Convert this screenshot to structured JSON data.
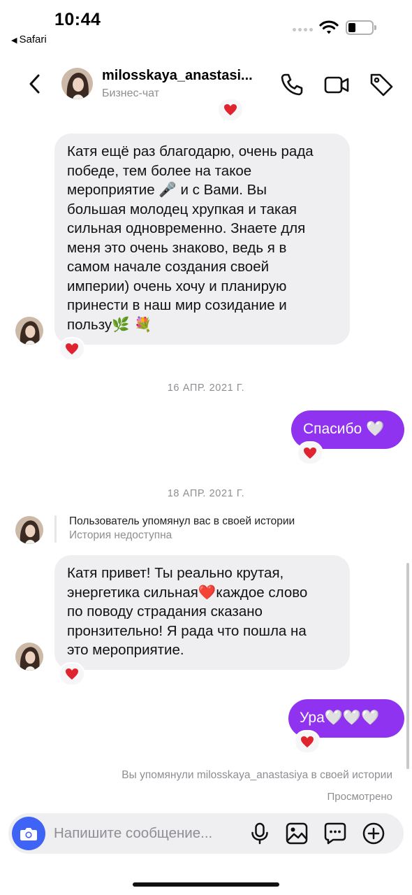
{
  "status_bar": {
    "time": "10:44",
    "back_app": "Safari",
    "back_glyph": "◀"
  },
  "header": {
    "username": "milosskaya_anastasi...",
    "subtitle": "Бизнес-чат",
    "icons": [
      "back-chevron-icon",
      "phone-icon",
      "video-camera-icon",
      "tag-icon"
    ]
  },
  "messages": {
    "msg1": {
      "sender": "incoming",
      "text_lines": [
        "Катя ещё раз благодарю, очень рада",
        "победе, тем более на такое",
        "мероприятие",
        "и с Вами. Вы",
        "большая молодец хрупкая и такая",
        "сильная одновременно. Знаете для",
        "меня это очень знаково, ведь я в",
        "самом начале создания своей",
        "империи) очень хочу и планирую",
        "принести в наш мир созидание и",
        "пользу"
      ],
      "emoji_mic": "🎤",
      "emoji_end": "🌿 💐",
      "reaction": "❤️"
    },
    "date1": "16 АПР. 2021 Г.",
    "msg2": {
      "sender": "outgoing",
      "text": "Спасибо",
      "emoji": "🤍",
      "reaction": "❤️"
    },
    "date2": "18 АПР. 2021 Г.",
    "story_mention": {
      "line1": "Пользователь упомянул вас в своей истории",
      "line2": "История недоступна"
    },
    "msg3": {
      "sender": "incoming",
      "line1": "Катя привет! Ты реально крутая,",
      "line2a": "энергетика сильная",
      "heart": "❤️",
      "line2b": "каждое слово",
      "line3": "по поводу страдания сказано",
      "line4": "пронзительно! Я рада что пошла на",
      "line5": "это мероприятие.",
      "reaction": "❤️"
    },
    "msg4": {
      "sender": "outgoing",
      "text": "Ура",
      "emoji": "🤍🤍🤍",
      "reaction": "❤️"
    },
    "mention_note": "Вы упомянули milosskaya_anastasiya в своей истории",
    "seen": "Просмотрено"
  },
  "composer": {
    "placeholder": "Напишите сообщение...",
    "icons": [
      "camera-icon",
      "microphone-icon",
      "gallery-icon",
      "sticker-chat-icon",
      "plus-icon"
    ]
  },
  "colors": {
    "outgoing_bubble": "#8f33f0",
    "incoming_bubble": "#efeff2",
    "camera_button": "#3f64f5",
    "reaction_heart": "#e0242f"
  }
}
